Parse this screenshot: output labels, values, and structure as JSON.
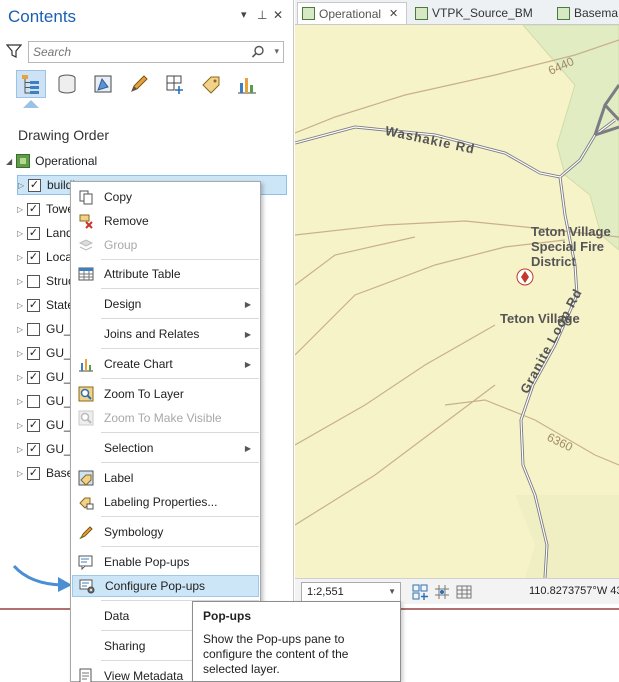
{
  "contents_pane": {
    "title": "Contents",
    "search_placeholder": "Search",
    "toolbar_icons": [
      "list-by-drawing-order-icon",
      "list-by-data-source-icon",
      "list-by-selection-icon",
      "list-by-editing-icon",
      "list-by-snapping-icon",
      "list-by-labeling-icon",
      "list-by-charts-icon"
    ],
    "section_heading": "Drawing Order",
    "map_name": "Operational",
    "layers": [
      {
        "name": "buildi",
        "checked": true
      },
      {
        "name": "Towe",
        "checked": true
      },
      {
        "name": "Land",
        "checked": true
      },
      {
        "name": "Loca",
        "checked": true
      },
      {
        "name": "Struc",
        "checked": false
      },
      {
        "name": "State",
        "checked": true
      },
      {
        "name": "GU_P",
        "checked": false
      },
      {
        "name": "GU_N",
        "checked": true
      },
      {
        "name": "GU_C",
        "checked": true
      },
      {
        "name": "GU_N",
        "checked": false
      },
      {
        "name": "GU_I",
        "checked": true
      },
      {
        "name": "GU_U",
        "checked": true
      },
      {
        "name": "Base",
        "checked": true
      }
    ]
  },
  "map_view": {
    "tabs": [
      {
        "label": "Operational",
        "active": true
      },
      {
        "label": "VTPK_Source_BM",
        "active": false
      },
      {
        "label": "Basema",
        "active": false
      }
    ],
    "labels": {
      "road_washakie": "Washakie Rd",
      "road_granite": "Granite Loop Rd",
      "contour_6440": "6440",
      "contour_6360": "6360",
      "fire_district_line1": "Teton Village",
      "fire_district_line2": "Special Fire",
      "fire_district_line3": "District",
      "place": "Teton Village"
    },
    "scale": "1:2,551",
    "coordinates": "110.8273757°W 43"
  },
  "context_menu": {
    "items": [
      {
        "label": "Copy",
        "icon": "copy-icon"
      },
      {
        "label": "Remove",
        "icon": "remove-icon"
      },
      {
        "label": "Group",
        "icon": "group-icon",
        "disabled": true
      },
      {
        "label": "Attribute Table",
        "icon": "attribute-table-icon"
      },
      {
        "label": "Design",
        "submenu": true
      },
      {
        "label": "Joins and Relates",
        "submenu": true
      },
      {
        "label": "Create Chart",
        "icon": "chart-icon",
        "submenu": true
      },
      {
        "label": "Zoom To Layer",
        "icon": "zoom-to-layer-icon"
      },
      {
        "label": "Zoom To Make Visible",
        "icon": "zoom-to-make-visible-icon",
        "disabled": true
      },
      {
        "label": "Selection",
        "submenu": true
      },
      {
        "label": "Label",
        "icon": "label-icon"
      },
      {
        "label": "Labeling Properties...",
        "icon": "labeling-properties-icon"
      },
      {
        "label": "Symbology",
        "icon": "symbology-icon"
      },
      {
        "label": "Enable Pop-ups",
        "icon": "enable-popups-icon"
      },
      {
        "label": "Configure Pop-ups",
        "icon": "configure-popups-icon",
        "hover": true
      },
      {
        "label": "Data",
        "submenu": true
      },
      {
        "label": "Sharing",
        "submenu": true
      },
      {
        "label": "View Metadata",
        "icon": "view-metadata-icon"
      }
    ]
  },
  "tooltip": {
    "title": "Pop-ups",
    "body": "Show the Pop-ups pane to configure the content of the selected layer."
  },
  "colors": {
    "title_blue": "#1a5fb4",
    "map_background": "#f6f3c9",
    "road": "#7c7c84",
    "selection_blue": "#cde6f7"
  }
}
